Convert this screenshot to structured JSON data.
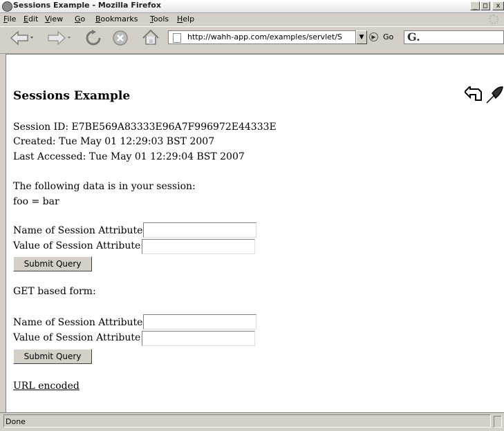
{
  "window": {
    "title": "Sessions Example - Mozilla Firefox",
    "controls": {
      "minimize": "_",
      "maximize": "□",
      "close": "x"
    }
  },
  "menubar": {
    "items": [
      {
        "label": "File",
        "accel": "F",
        "rest": "ile"
      },
      {
        "label": "Edit",
        "accel": "E",
        "rest": "dit"
      },
      {
        "label": "View",
        "accel": "V",
        "rest": "iew"
      },
      {
        "label": "Go",
        "accel": "G",
        "rest": "o"
      },
      {
        "label": "Bookmarks",
        "accel": "B",
        "rest": "ookmarks"
      },
      {
        "label": "Tools",
        "accel": "T",
        "rest": "ools"
      },
      {
        "label": "Help",
        "accel": "H",
        "rest": "elp"
      }
    ]
  },
  "toolbar": {
    "url": "http://wahh-app.com/examples/servlet/S",
    "go_label": "Go",
    "search_glyph": "G."
  },
  "page": {
    "heading": "Sessions Example",
    "session_id": "Session ID: E7BE569A83333E96A7F996972E44333E",
    "created": "Created: Tue May 01 12:29:03 BST 2007",
    "last_accessed": "Last Accessed: Tue May 01 12:29:04 BST 2007",
    "data_intro": "The following data is in your session:",
    "data_item": "foo = bar",
    "post_form": {
      "name_label": "Name of Session Attribute:",
      "value_label": "Value of Session Attribute:",
      "name_value": "",
      "value_value": "",
      "submit_label": "Submit Query"
    },
    "get_form_label": "GET based form:",
    "get_form": {
      "name_label": "Name of Session Attribute:",
      "value_label": "Value of Session Attribute:",
      "name_value": "",
      "value_value": "",
      "submit_label": "Submit Query"
    },
    "url_encoded_link": "URL encoded"
  },
  "status": {
    "text": "Done"
  }
}
